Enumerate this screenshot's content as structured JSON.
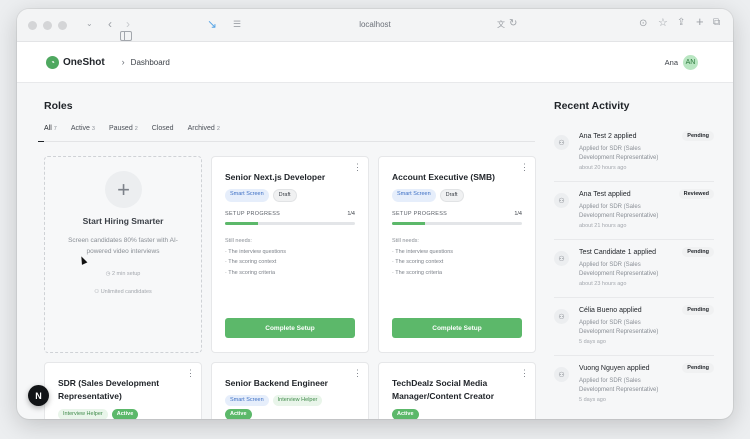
{
  "browser": {
    "url": "localhost",
    "icons": [
      "sidebar-icon",
      "chevron-down-icon",
      "back-icon",
      "forward-icon",
      "download-arrow-icon",
      "reader-icon",
      "translate-icon",
      "reload-icon",
      "downloads-icon",
      "star-icon",
      "share-icon",
      "new-tab-icon",
      "tabs-icon"
    ]
  },
  "header": {
    "app_name": "OneShot",
    "breadcrumb": "Dashboard",
    "user_name": "Ana",
    "user_initials": "AN"
  },
  "roles": {
    "title": "Roles",
    "tabs": [
      {
        "label": "All",
        "count": "7"
      },
      {
        "label": "Active",
        "count": "3"
      },
      {
        "label": "Paused",
        "count": "2"
      },
      {
        "label": "Closed",
        "count": ""
      },
      {
        "label": "Archived",
        "count": "2"
      }
    ],
    "start_card": {
      "title": "Start Hiring Smarter",
      "description": "Screen candidates 80% faster with AI-powered video interviews",
      "setup_time": "2 min setup",
      "candidates": "Unlimited candidates"
    },
    "cards": [
      {
        "title": "Senior Next.js Developer",
        "badges": [
          "Smart Screen",
          "Draft"
        ],
        "setup_label": "SETUP PROGRESS",
        "setup_progress": "1/4",
        "progress_value": 0.25,
        "needs_title": "Still needs:",
        "needs": [
          "· The interview questions",
          "· The scoring context",
          "· The scoring criteria"
        ],
        "cta": "Complete Setup"
      },
      {
        "title": "Account Executive (SMB)",
        "badges": [
          "Smart Screen",
          "Draft"
        ],
        "setup_label": "SETUP PROGRESS",
        "setup_progress": "1/4",
        "progress_value": 0.25,
        "needs_title": "Still needs:",
        "needs": [
          "· The interview questions",
          "· The scoring context",
          "· The scoring criteria"
        ],
        "cta": "Complete Setup"
      },
      {
        "title_line1": "SDR (Sales Development",
        "title_line2": "Representative)",
        "badges": [
          "Interview Helper",
          "Active"
        ]
      },
      {
        "title": "Senior Backend Engineer",
        "badges": [
          "Smart Screen",
          "Interview Helper",
          "Active"
        ]
      },
      {
        "title_line1": "TechDealz Social Media",
        "title_line2": "Manager/Content Creator",
        "badges": [
          "Active"
        ]
      }
    ]
  },
  "activity": {
    "title": "Recent Activity",
    "items": [
      {
        "name": "Ana Test 2 applied",
        "desc": "Applied for SDR (Sales Development Representative)",
        "time": "about 20 hours ago",
        "status": "Pending"
      },
      {
        "name": "Ana Test applied",
        "desc": "Applied for SDR (Sales Development Representative)",
        "time": "about 21 hours ago",
        "status": "Reviewed"
      },
      {
        "name": "Test Candidate 1 applied",
        "desc": "Applied for SDR (Sales Development Representative)",
        "time": "about 23 hours ago",
        "status": "Pending"
      },
      {
        "name": "Célia Bueno applied",
        "desc": "Applied for SDR (Sales Development Representative)",
        "time": "5 days ago",
        "status": "Pending"
      },
      {
        "name": "Vuong Nguyen applied",
        "desc": "Applied for SDR (Sales Development Representative)",
        "time": "5 days ago",
        "status": "Pending"
      }
    ]
  },
  "fab_label": "N",
  "colors": {
    "accent": "#5cb86a",
    "smart_screen": "#3d6fc4"
  }
}
